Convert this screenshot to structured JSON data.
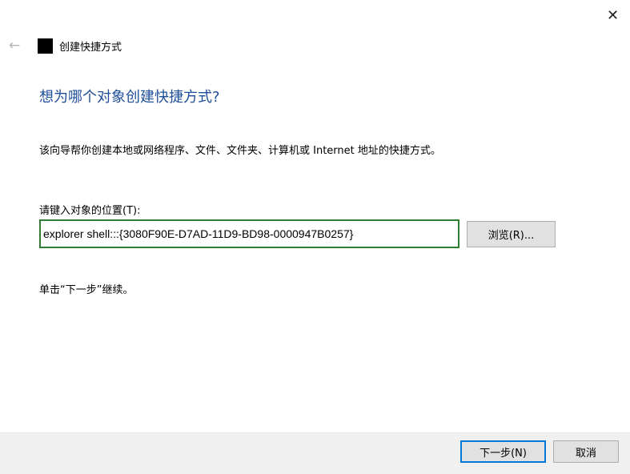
{
  "window": {
    "title": "创建快捷方式",
    "close_glyph": "✕",
    "back_glyph": "←"
  },
  "main": {
    "heading": "想为哪个对象创建快捷方式?",
    "description": "该向导帮你创建本地或网络程序、文件、文件夹、计算机或 Internet 地址的快捷方式。",
    "location_label": "请键入对象的位置(T):",
    "location_value": "explorer shell:::{3080F90E-D7AD-11D9-BD98-0000947B0257}",
    "browse_label": "浏览(R)...",
    "hint": "单击“下一步”继续。"
  },
  "footer": {
    "next_label": "下一步(N)",
    "cancel_label": "取消"
  },
  "colors": {
    "heading": "#1e4e99",
    "input_focus_border": "#2e7d32",
    "default_button_border": "#0078d7",
    "footer_bg": "#f0f0f0"
  },
  "icons": {
    "back": "back-arrow-icon",
    "close": "close-icon",
    "title": "shortcut-app-icon"
  }
}
